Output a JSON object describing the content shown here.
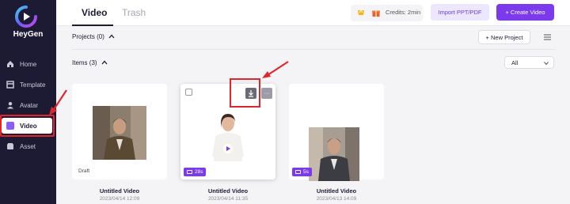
{
  "app": {
    "name": "HeyGen"
  },
  "sidebar": {
    "items": [
      {
        "label": "Home",
        "icon": "home-icon"
      },
      {
        "label": "Template",
        "icon": "template-icon"
      },
      {
        "label": "Avatar",
        "icon": "avatar-icon"
      },
      {
        "label": "Video",
        "icon": "video-icon",
        "active": true
      },
      {
        "label": "Asset",
        "icon": "asset-icon"
      }
    ]
  },
  "header": {
    "tabs": [
      {
        "label": "Video",
        "active": true
      },
      {
        "label": "Trash",
        "active": false
      }
    ],
    "credits": "Credits: 2min",
    "import_label": "Import PPT/PDF",
    "create_label": "+ Create Video"
  },
  "projects": {
    "label": "Projects (0)",
    "new_label": "+ New Project"
  },
  "items": {
    "label": "Items (3)",
    "filter_value": "All"
  },
  "cards": [
    {
      "title": "Untitled Video",
      "date": "2023/04/14 12:09",
      "status": "Draft"
    },
    {
      "title": "Untitled Video",
      "date": "2023/04/14 11:35",
      "duration": "28s"
    },
    {
      "title": "Untitled Video",
      "date": "2023/04/13 14:09",
      "duration": "5s"
    }
  ],
  "colors": {
    "sidebar": "#1d1b33",
    "accent": "#7c3aed",
    "highlight": "#e0262d"
  }
}
